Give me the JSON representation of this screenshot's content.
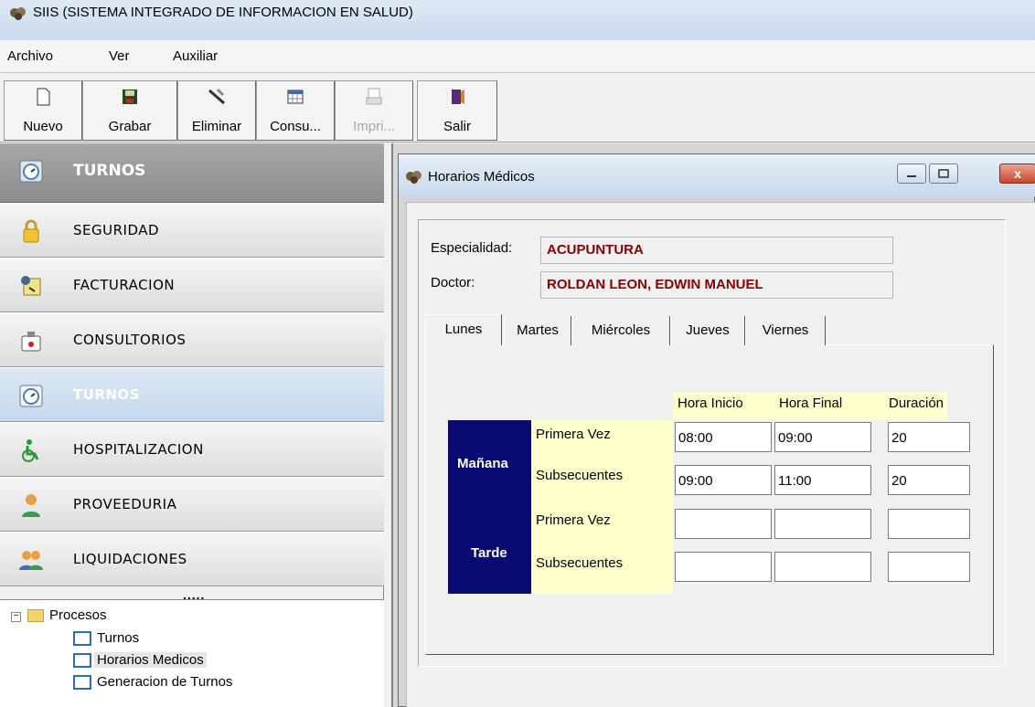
{
  "app": {
    "title": "SIIS (SISTEMA INTEGRADO DE INFORMACION EN SALUD)"
  },
  "menu": {
    "items": [
      "Archivo",
      "Ver",
      "Auxiliar"
    ]
  },
  "toolbar": {
    "buttons": [
      {
        "label": "Nuevo",
        "icon": "new-document-icon",
        "enabled": true
      },
      {
        "label": "Grabar",
        "icon": "save-icon",
        "enabled": true
      },
      {
        "label": "Eliminar",
        "icon": "delete-icon",
        "enabled": true
      },
      {
        "label": "Consu...",
        "icon": "query-icon",
        "enabled": true
      },
      {
        "label": "Impri...",
        "icon": "print-icon",
        "enabled": false
      },
      {
        "label": "Salir",
        "icon": "exit-icon",
        "enabled": true
      }
    ]
  },
  "sidebar": {
    "header": "TURNOS",
    "items": [
      {
        "label": "SEGURIDAD",
        "icon": "lock-icon",
        "selected": false
      },
      {
        "label": "FACTURACION",
        "icon": "billing-icon",
        "selected": false
      },
      {
        "label": "CONSULTORIOS",
        "icon": "medical-kit-icon",
        "selected": false
      },
      {
        "label": "TURNOS",
        "icon": "stopwatch-icon",
        "selected": true
      },
      {
        "label": "HOSPITALIZACION",
        "icon": "wheelchair-icon",
        "selected": false
      },
      {
        "label": "PROVEEDURIA",
        "icon": "person-icon",
        "selected": false
      },
      {
        "label": "LIQUIDACIONES",
        "icon": "people-icon",
        "selected": false
      }
    ],
    "grip": ".....",
    "tree": {
      "root": "Procesos",
      "children": [
        "Turnos",
        "Horarios Medicos",
        "Generacion de Turnos"
      ],
      "selected": "Horarios Medicos"
    }
  },
  "window": {
    "title": "Horarios Médicos",
    "close_label": "x",
    "form": {
      "especialidad_label": "Especialidad:",
      "especialidad_value": "ACUPUNTURA",
      "doctor_label": "Doctor:",
      "doctor_value": "ROLDAN LEON, EDWIN MANUEL"
    },
    "tabs": [
      "Lunes",
      "Martes",
      "Miércoles",
      "Jueves",
      "Viernes"
    ],
    "active_tab": "Lunes",
    "grid": {
      "headers": [
        "Hora Inicio",
        "Hora Final",
        "Duración"
      ],
      "shifts": [
        {
          "name": "Mañana",
          "rows": [
            {
              "label": "Primera Vez",
              "inicio": "08:00",
              "final": "09:00",
              "duracion": "20"
            },
            {
              "label": "Subsecuentes",
              "inicio": "09:00",
              "final": "11:00",
              "duracion": "20"
            }
          ]
        },
        {
          "name": "Tarde",
          "rows": [
            {
              "label": "Primera Vez",
              "inicio": "",
              "final": "",
              "duracion": ""
            },
            {
              "label": "Subsecuentes",
              "inicio": "",
              "final": "",
              "duracion": ""
            }
          ]
        }
      ]
    }
  },
  "colors": {
    "accent_dark_blue": "#0a0a73",
    "value_red": "#8b0000",
    "grid_yellow": "#ffffcc",
    "selected_nav": "#c5d8ec"
  }
}
